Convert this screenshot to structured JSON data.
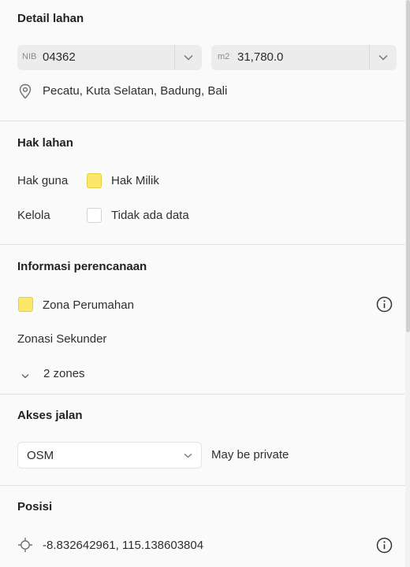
{
  "detail": {
    "heading": "Detail lahan",
    "nib": {
      "prefix": "NIB",
      "value": "04362"
    },
    "area": {
      "prefix": "m2",
      "value": "31,780.0"
    },
    "location": "Pecatu, Kuta Selatan, Badung, Bali"
  },
  "hak": {
    "heading": "Hak lahan",
    "rows": [
      {
        "label": "Hak guna",
        "value": "Hak Milik",
        "color": "#fbe76a"
      },
      {
        "label": "Kelola",
        "value": "Tidak ada data",
        "color": "#ffffff"
      }
    ]
  },
  "planning": {
    "heading": "Informasi perencanaan",
    "zone": "Zona Perumahan",
    "zone_color": "#fbe76a",
    "secondary_label": "Zonasi Sekunder",
    "zones_toggle": "2 zones"
  },
  "akses": {
    "heading": "Akses jalan",
    "source": "OSM",
    "status": "May be private"
  },
  "posisi": {
    "heading": "Posisi",
    "coords": "-8.832642961, 115.138603804"
  }
}
